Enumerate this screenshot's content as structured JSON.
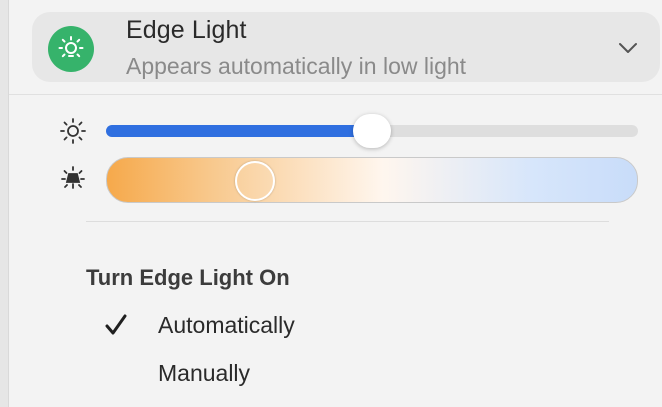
{
  "header": {
    "title": "Edge Light",
    "subtitle": "Appears automatically in low light",
    "icon": "lightbulb-icon",
    "icon_color": "#36b36b"
  },
  "controls": {
    "brightness": {
      "icon": "sun-icon",
      "value_fraction": 0.5,
      "accent_color": "#2f6fe0"
    },
    "color_temperature": {
      "icon": "desk-lamp-icon",
      "value_fraction": 0.28,
      "warm_color": "#f6a94b",
      "cool_color": "#c8dcf9"
    }
  },
  "turn_on": {
    "heading": "Turn Edge Light On",
    "options": [
      {
        "label": "Automatically",
        "selected": true
      },
      {
        "label": "Manually",
        "selected": false
      }
    ]
  }
}
